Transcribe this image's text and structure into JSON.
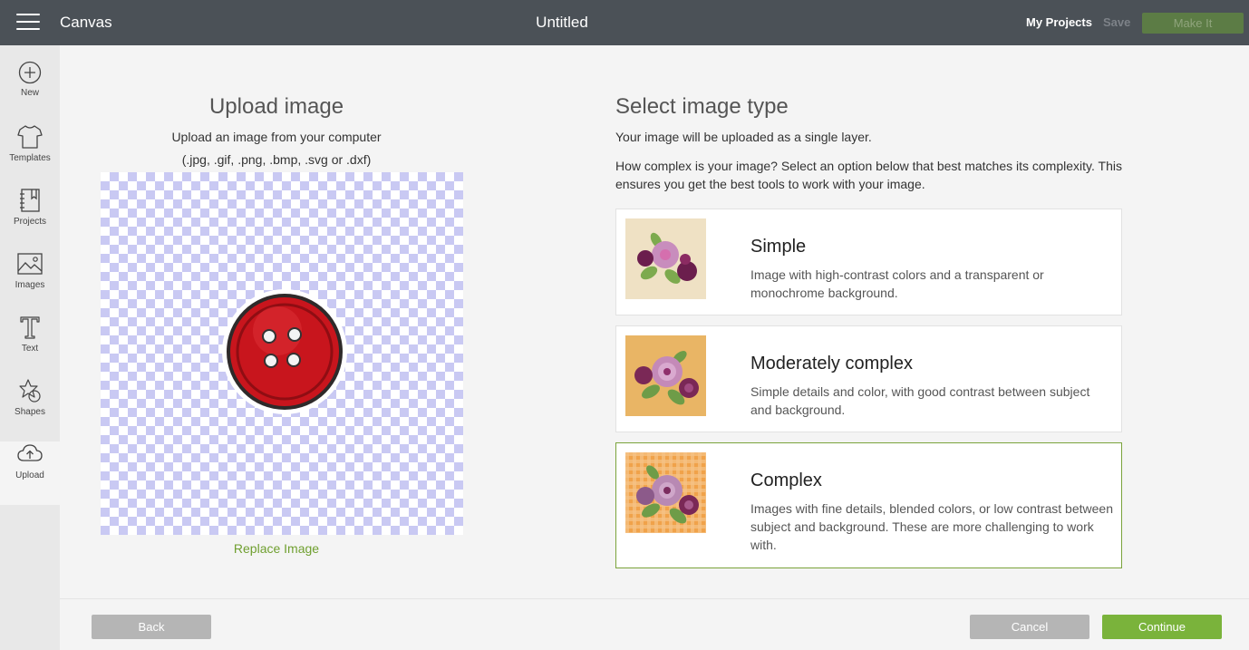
{
  "topbar": {
    "app_title": "Canvas",
    "document_title": "Untitled",
    "my_projects": "My Projects",
    "save": "Save",
    "make_it": "Make It"
  },
  "sidebar": {
    "items": [
      {
        "label": "New",
        "icon": "plus-circle-icon"
      },
      {
        "label": "Templates",
        "icon": "tshirt-icon"
      },
      {
        "label": "Projects",
        "icon": "notebook-icon"
      },
      {
        "label": "Images",
        "icon": "image-icon"
      },
      {
        "label": "Text",
        "icon": "text-icon"
      },
      {
        "label": "Shapes",
        "icon": "shapes-icon"
      },
      {
        "label": "Upload",
        "icon": "cloud-upload-icon",
        "active": true
      }
    ]
  },
  "upload": {
    "title": "Upload image",
    "subtitle": "Upload an image from your computer",
    "extensions": "(.jpg, .gif, .png, .bmp, .svg or .dxf)",
    "replace_link": "Replace Image"
  },
  "image_type": {
    "title": "Select image type",
    "subtitle": "Your image will be uploaded as a single layer.",
    "question": "How complex is your image? Select an option below that best matches its complexity. This ensures you get the best tools to work with your image.",
    "options": [
      {
        "title": "Simple",
        "description": "Image with high-contrast colors and a transparent or monochrome background.",
        "selected": false
      },
      {
        "title": "Moderately complex",
        "description": "Simple details and color, with good contrast between subject and background.",
        "selected": false
      },
      {
        "title": "Complex",
        "description": "Images with fine details, blended colors, or low contrast between subject and background. These are more challenging to work with.",
        "selected": true
      }
    ]
  },
  "footer": {
    "back": "Back",
    "cancel": "Cancel",
    "continue": "Continue"
  },
  "colors": {
    "topbar": "#4b5157",
    "accent_green": "#7ab33b",
    "link_green": "#6f9f2f",
    "selected_border": "#7aa33b"
  }
}
